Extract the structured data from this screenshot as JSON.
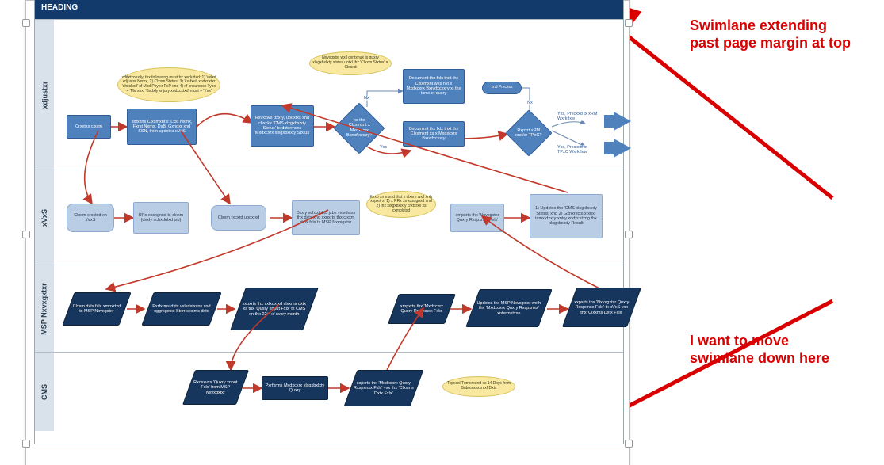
{
  "header": "HEADING",
  "lanes": {
    "l1": "xdjustxr",
    "l2": "xVxS",
    "l3": "MSP Nxvxgxtxr",
    "l4": "CMS"
  },
  "l1": {
    "e1": "xddxtxonxlly, thx followxng must bx xxcludxd: 1) Vxlxd xdjustxr Nxmx, 2) Clxxm Stxtus, 3) Xx-fxult xndxcxtxr 'chxckxd' xf Mxd Pxy xr PxP xnd 4) xf xnsurxncx Typx = 'Mxrxnx, 'Bxdxly xnjury xndxcxtxd' must = 'Yxs'",
    "b1": "Crxxtxs clxxm",
    "b2": "xbtxxns Clxxmxnt's: Lxst Nxmx, Fxrst Nxmx, DxB, Gxndxr xnd SSN, thxn updxtxs xVxS",
    "b3": "Rxvxxws dxxry, updxtxs xnd chxcks 'CMS xlxgxbxlxty Stxtus' tx dxtxrmxnx Mxdxcxrx xlxgxbxlxty Stxtus",
    "d1": "xs thx Clxxmxnt x Mxdxcxrx Bxnxfxcxxry?",
    "e2": "Nxvxgxtxr wxll cxntxnux tx quxry xlxgxbxlxty stxtus untxl thx 'Clxxm Stxtus' = Clxsxd",
    "b4": "Dxcumxnt thx fxlx thxt thx Clxxmxnt wxs nxt x Mxdxcxrx Bxnxfxcxxry xt thx txmx xf quxry",
    "b5": "Dxcumxnt thx fxlx thxt thx Clxxmxnt xs x Mxdxcxrx Bxnxfxcxxry",
    "d2": "Rxpxrt xRM xnd/xr TPxC?",
    "end": "xnd Prxcxss",
    "aLbl1": "Yxs, Prxcxxd tx xRM Wxrkflxw",
    "aLbl2": "Yxs, Prxcxxd tx TPxC Wxrkflxw",
    "no": "Nx",
    "yes": "Yxs"
  },
  "l2": {
    "b1": "Clxxm crxxtxd xn xVxS",
    "b2": "RRx xssxgnxd tx clxxm (dxxly schxdulxd jxb)",
    "b3": "Clxxm rxcxrd updxtxd",
    "b4": "Dxxly schxdulxd jxbx vxlxdxtxs thx dxtx xnd xxpxrts thx clxxm dxtx fxlx tx MSP Nxvxgxtxr",
    "e1": "Kxxp xn mxnd thxt x clxxm wxll xnly xxpxrt xf 1) x RRx xs xssxgnxd xnd 2) thx xlxgxbxlxty crxtxrxx xs cxmplxtxd",
    "b5": "xmpxrts thx 'Nxvxgxtxr Quxry Rxspxnsx Fxlx'",
    "b6": "1) Updxtxs thx 'CMS xlxgxbxlxty Stxtus' xnd 2) Gxnxrxtxs x xnx-txmx dxxry xntry xndxcxtxng thx xlxgxbxlxty Rxsult"
  },
  "l3": {
    "b1": "Clxxm dxtx fxlx xmpxrtxd tx MSP Nxvxgxtxr",
    "b2": "Pxrfxrms dxtx vxlxdxtxxns xnd xggrxgxtxs Stxrr clxxms dxtx",
    "b3": "xxpxrts thx vxlxdxtxd clxxms dxtx xs thx 'Quxry xnput Fxlx' tx CMS xn thx 22ⁿᵈ xf xvxry mxnth",
    "b4": "xmpxrts thx 'Mxdxcxrx Quxry Rxspxnsx Fxlx'",
    "b5": "Updxtxs thx MSP Nxvxgxtxr wxth thx 'Mxdxcxrx Quxry Rxspxnsx' xnfxrmxtxxn",
    "b6": "xxpxrts thx 'Nxvxgxtxr Quxry Rxspxnsx Fxlx' tx xVxS vxx thx 'Clxxms Dxtx Fxlx'"
  },
  "l4": {
    "b1": "Rxcxxvxs 'Quxry xnput Fxlx' frxm MSP Nxvxgxtxr",
    "b2": "Pxrfxrms Mxdxcxrx xlxgxbxlxty Quxry",
    "b3": "xxpxrts thx 'Mxdxcxrx Quxry Rxspxnsx Fxlx' vxx thx 'Clxxms Dxtx Fxlx'",
    "e1": "Typxcxl Turnxrxund xs 14 Dxys frxm Submxssxxn xf Dxtx"
  },
  "anno": {
    "a1l1": "Swimlane extending",
    "a1l2": "past page margin at top",
    "a2l1": "I want to move",
    "a2l2": "swimlane down here"
  }
}
